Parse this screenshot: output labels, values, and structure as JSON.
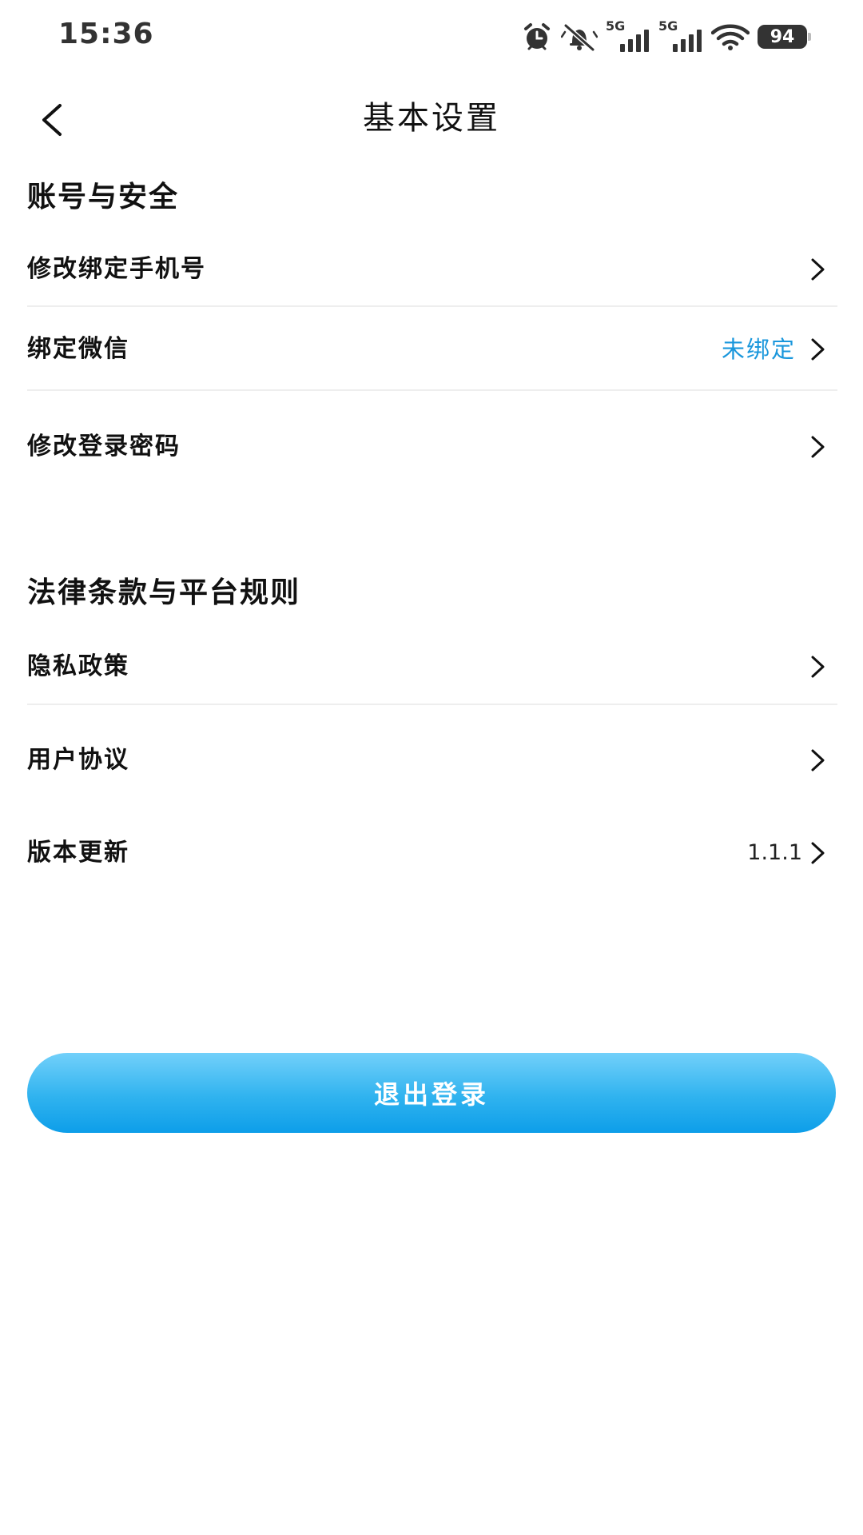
{
  "status_bar": {
    "time": "15:36",
    "network_1": "5G",
    "network_2": "5G",
    "battery": "94",
    "icons": [
      "alarm-icon",
      "muted-bell-icon",
      "signal-icon",
      "signal-icon",
      "wifi-icon",
      "battery-icon"
    ]
  },
  "header": {
    "title": "基本设置",
    "back_icon": "chevron-left-icon"
  },
  "sections": [
    {
      "title": "账号与安全",
      "items": [
        {
          "label": "修改绑定手机号",
          "value": ""
        },
        {
          "label": "绑定微信",
          "value": "未绑定"
        },
        {
          "label": "修改登录密码",
          "value": ""
        }
      ]
    },
    {
      "title": "法律条款与平台规则",
      "items": [
        {
          "label": "隐私政策",
          "value": ""
        },
        {
          "label": "用户协议",
          "value": ""
        },
        {
          "label": "版本更新",
          "value": "1.1.1"
        }
      ]
    }
  ],
  "logout_label": "退出登录",
  "colors": {
    "accent": "#1a97dc",
    "button_top": "#72d0fa",
    "button_bottom": "#0d9ee9",
    "divider": "#eeeeee"
  }
}
